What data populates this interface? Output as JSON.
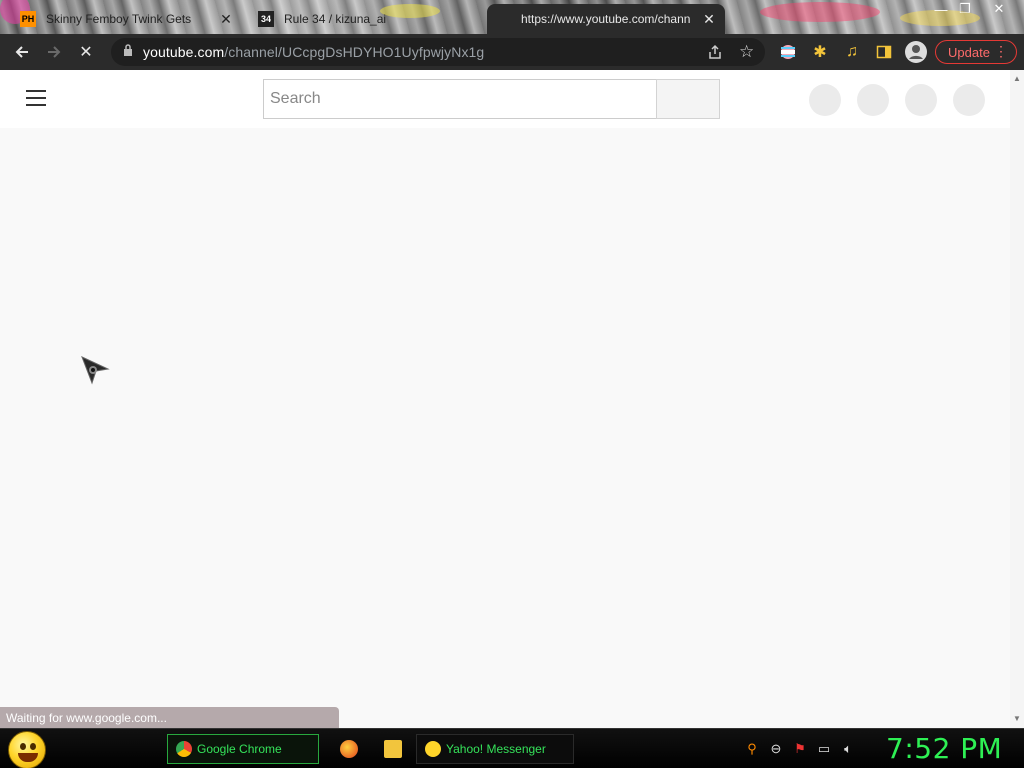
{
  "browser": {
    "tabs": [
      {
        "title": "Skinny Femboy Twink Gets",
        "favicon": "PH",
        "active": false
      },
      {
        "title": "Rule 34 / kizuna_ai",
        "favicon": "34",
        "active": false
      },
      {
        "title": "https://www.youtube.com/chann",
        "favicon": "",
        "active": true
      }
    ],
    "url_host": "youtube.com",
    "url_path": "/channel/UCcpgDsHDYHO1UyfpwjyNx1g",
    "update_label": "Update",
    "status_text": "Waiting for www.google.com..."
  },
  "youtube": {
    "search_placeholder": "Search"
  },
  "taskbar": {
    "tasks": [
      {
        "label": "Google Chrome"
      },
      {
        "label": "Yahoo! Messenger"
      }
    ],
    "clock": "7:52 PM"
  },
  "colors": {
    "accent_green": "#2ef054",
    "update_red": "#e53935",
    "toolbar_bg": "#2b2b2b"
  }
}
